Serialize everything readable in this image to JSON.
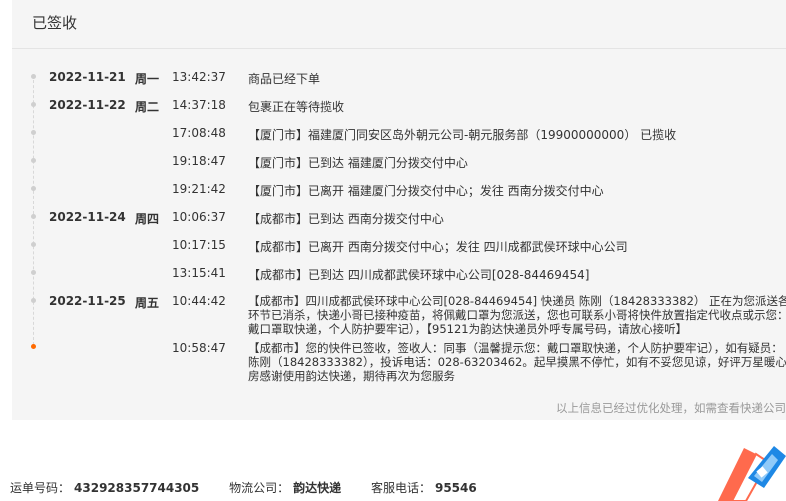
{
  "panel": {
    "title": "已签收",
    "note": "以上信息已经过优化处理，如需查看快递公司"
  },
  "events": [
    {
      "date": "2022-11-21",
      "week": "周一",
      "time": "13:42:37",
      "desc": "商品已经下单"
    },
    {
      "date": "2022-11-22",
      "week": "周二",
      "time": "14:37:18",
      "desc": "包裹正在等待揽收"
    },
    {
      "date": "",
      "week": "",
      "time": "17:08:48",
      "desc": "【厦门市】福建厦门同安区岛外朝元公司-朝元服务部（19900000000） 已揽收"
    },
    {
      "date": "",
      "week": "",
      "time": "19:18:47",
      "desc": "【厦门市】已到达 福建厦门分拨交付中心"
    },
    {
      "date": "",
      "week": "",
      "time": "19:21:42",
      "desc": "【厦门市】已离开 福建厦门分拨交付中心；发往 西南分拨交付中心"
    },
    {
      "date": "2022-11-24",
      "week": "周四",
      "time": "10:06:37",
      "desc": "【成都市】已到达 西南分拨交付中心"
    },
    {
      "date": "",
      "week": "",
      "time": "10:17:15",
      "desc": "【成都市】已离开 西南分拨交付中心；发往 四川成都武侯环球中心公司"
    },
    {
      "date": "",
      "week": "",
      "time": "13:15:41",
      "desc": "【成都市】已到达 四川成都武侯环球中心公司[028-84469454]"
    },
    {
      "date": "2022-11-25",
      "week": "周五",
      "time": "10:44:42",
      "desc": "【成都市】四川成都武侯环球中心公司[028-84469454] 快递员 陈刚（18428333382） 正在为您派送各环节已消杀，快递小哥已接种疫苗，将佩戴口罩为您派送，您也可联系小哥将快件放置指定代收点或示您：戴口罩取快递，个人防护要牢记），【95121为韵达快递员外呼专属号码，请放心接听】"
    },
    {
      "date": "",
      "week": "",
      "time": "10:58:47",
      "desc": "【成都市】您的快件已签收，签收人：同事（温馨提示您：戴口罩取快递，个人防护要牢记），如有疑员：陈刚（18428333382），投诉电话：028-63203462。起早摸黑不停忙，如有不妥您见谅，好评万星暖心房感谢使用韵达快递，期待再次为您服务"
    }
  ],
  "footer": {
    "tracking_label": "运单号码：",
    "tracking_value": "432928357744305",
    "company_label": "物流公司：",
    "company_value": "韵达快递",
    "phone_label": "客服电话：",
    "phone_value": "95546"
  },
  "colors": {
    "accent": "#ff6a00",
    "panel_bg": "#f5f5f5"
  },
  "icons": {
    "corner": "delivery-hand-icon"
  }
}
